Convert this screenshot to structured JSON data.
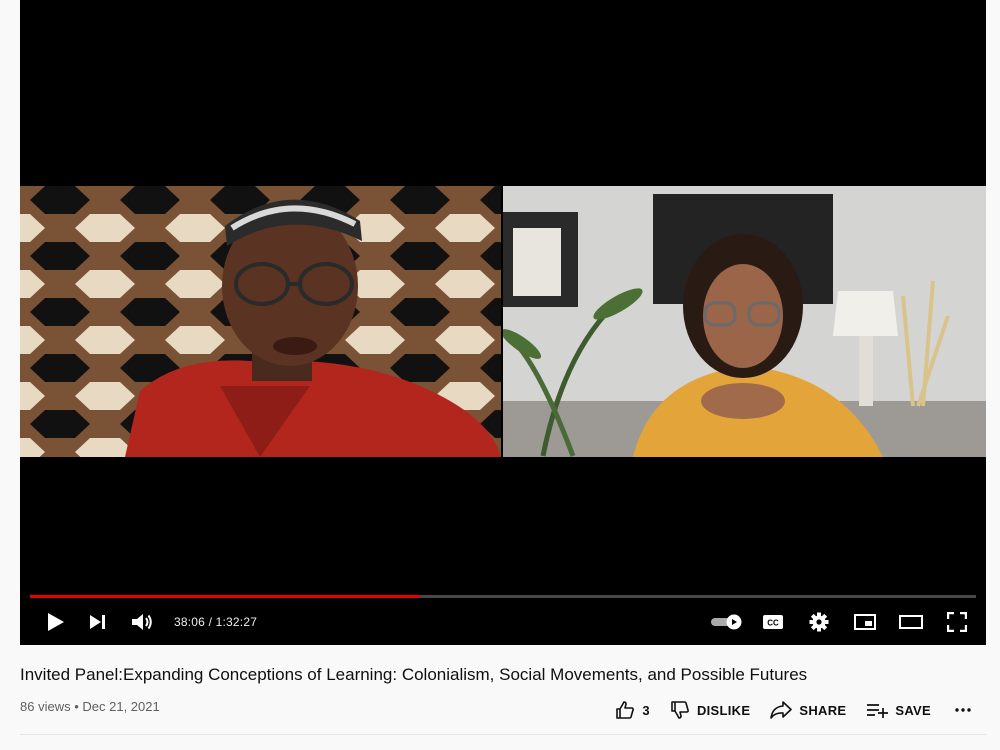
{
  "player": {
    "time_display": "38:06 / 1:32:27",
    "progress_played_fraction": 0.412,
    "accent_color": "#e60000",
    "controls": {
      "play_icon": "play-icon",
      "next_icon": "next-track-icon",
      "volume_icon": "volume-icon",
      "autoplay_icon": "autoplay-toggle-icon",
      "captions_label": "CC",
      "settings_icon": "gear-icon",
      "miniplayer_icon": "miniplayer-icon",
      "theater_icon": "theater-mode-icon",
      "fullscreen_icon": "fullscreen-icon"
    }
  },
  "video": {
    "title": "Invited Panel:Expanding Conceptions of Learning: Colonialism, Social Movements, and Possible Futures",
    "views": "86 views",
    "separator": "•",
    "date": "Dec 21, 2021"
  },
  "actions": {
    "like_count": "3",
    "dislike_label": "DISLIKE",
    "share_label": "SHARE",
    "save_label": "SAVE",
    "more_icon": "more-horizontal-icon"
  }
}
